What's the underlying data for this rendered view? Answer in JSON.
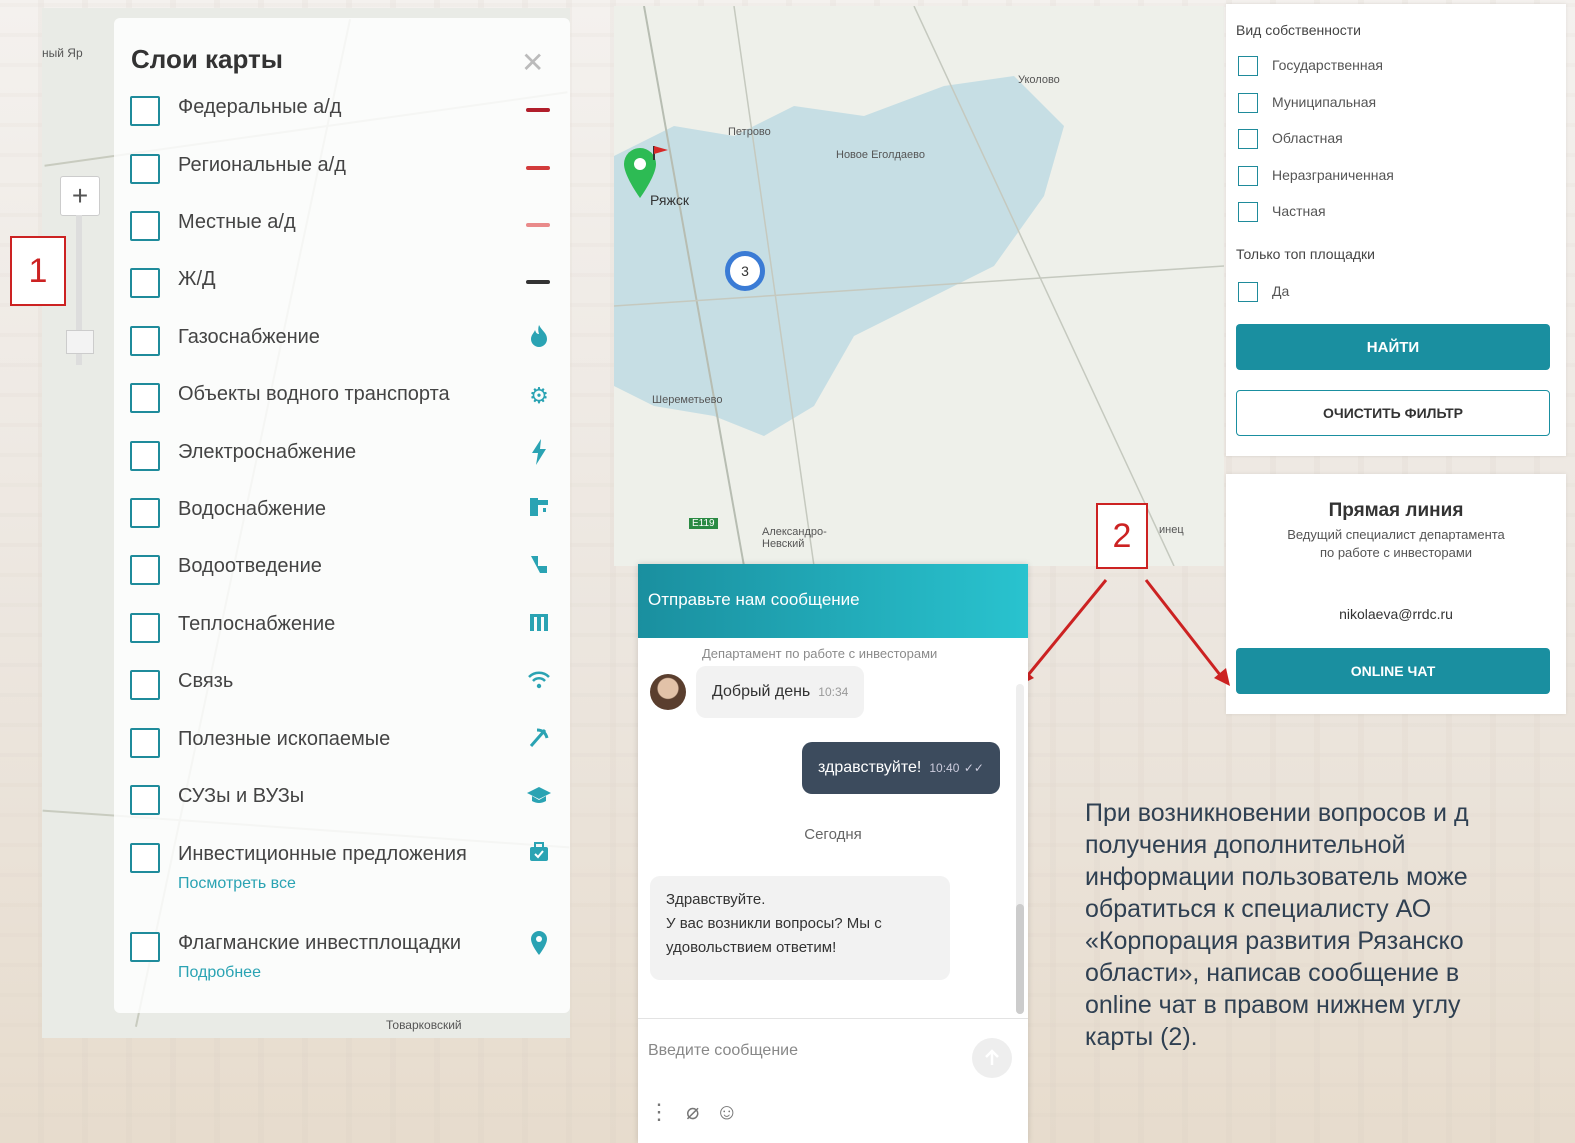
{
  "layers": {
    "title": "Слои карты",
    "items": [
      {
        "label": "Федеральные а/д",
        "legend": "#b11e2b"
      },
      {
        "label": "Региональные а/д",
        "legend": "#d23b3b"
      },
      {
        "label": "Местные а/д",
        "legend": "#e98a8a"
      },
      {
        "label": "Ж/Д",
        "legend": "#333333"
      },
      {
        "label": "Газоснабжение",
        "icon": "flame-icon"
      },
      {
        "label": "Объекты водного транспорта",
        "icon": "anchor-icon"
      },
      {
        "label": "Электроснабжение",
        "icon": "lightning-icon"
      },
      {
        "label": "Водоснабжение",
        "icon": "faucet-icon"
      },
      {
        "label": "Водоотведение",
        "icon": "pipe-icon"
      },
      {
        "label": "Теплоснабжение",
        "icon": "heating-icon"
      },
      {
        "label": "Связь",
        "icon": "wifi-icon"
      },
      {
        "label": "Полезные ископаемые",
        "icon": "mining-icon"
      },
      {
        "label": "СУЗы и ВУЗы",
        "icon": "graduation-cap-icon"
      },
      {
        "label": "Инвестиционные предложения",
        "sub": "Посмотреть все",
        "icon": "briefcase-icon"
      },
      {
        "label": "Флагманские инвестплощадки",
        "sub": "Подробнее",
        "icon": "location-pin-icon"
      }
    ]
  },
  "left_map": {
    "places": [
      "ный Яр",
      "Товарковский"
    ]
  },
  "callouts": [
    "1",
    "2"
  ],
  "right_map": {
    "places": [
      "Уколово",
      "Петрово",
      "Новое Еголдаево",
      "Ряжск",
      "Шереметьево",
      "Александро-Невский",
      "E119",
      "инец"
    ],
    "cluster_count": "3"
  },
  "filter": {
    "ownership_heading": "Вид собственности",
    "ownership_options": [
      "Государственная",
      "Муниципальная",
      "Областная",
      "Неразграниченная",
      "Частная"
    ],
    "top_heading": "Только топ площадки",
    "top_option": "Да",
    "find_label": "НАЙТИ",
    "clear_label": "ОЧИСТИТЬ ФИЛЬТР"
  },
  "direct_line": {
    "title": "Прямая линия",
    "subtitle": "Ведущий специалист департамента по работе с инвесторами",
    "email": "nikolaeva@rrdc.ru",
    "chat_button": "ONLINE ЧАТ"
  },
  "chat": {
    "header": "Отправьте нам сообщение",
    "department": "Департамент по работе с инвесторами",
    "messages": [
      {
        "from": "agent",
        "text": "Добрый день",
        "time": "10:34"
      },
      {
        "from": "user",
        "text": "здравствуйте!",
        "time": "10:40"
      }
    ],
    "today_label": "Сегодня",
    "auto_message": [
      "Здравствуйте.",
      "У вас возникли вопросы? Мы с",
      "удовольствием ответим!"
    ],
    "input_placeholder": "Введите сообщение"
  },
  "info_text": [
    "При возникновении вопросов и д",
    "получения дополнительной",
    "информации пользователь може",
    "обратиться к специалисту АО",
    "«Корпорация развития Рязанско",
    "области», написав сообщение в",
    "online чат в правом нижнем углу",
    "карты (2)."
  ]
}
